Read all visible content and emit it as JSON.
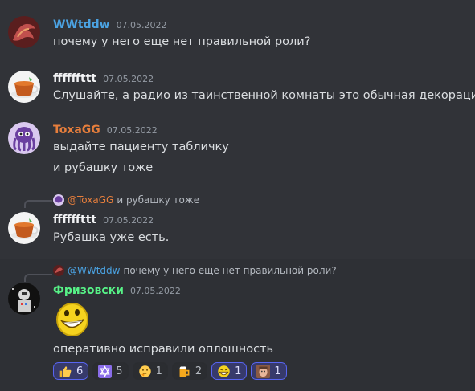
{
  "messages": [
    {
      "author": "WWtddw",
      "author_color": "#4ba3e3",
      "timestamp": "07.05.2022",
      "lines": [
        "почему у него еще нет правильной роли?"
      ]
    },
    {
      "author": "ffffffttt",
      "author_color": "#f2f3f5",
      "timestamp": "07.05.2022",
      "lines": [
        "Слушайте, а радио из таинственной комнаты это обычная декорация?"
      ]
    },
    {
      "author": "ToxaGG",
      "author_color": "#e67e3c",
      "timestamp": "07.05.2022",
      "lines": [
        "выдайте пациенту табличку",
        "и рубашку тоже"
      ]
    },
    {
      "author": "ffffffttt",
      "author_color": "#f2f3f5",
      "timestamp": "07.05.2022",
      "lines": [
        "Рубашка уже есть."
      ],
      "reply": {
        "mention": "@ToxaGG",
        "text": "и рубашку тоже",
        "mention_color": "#e67e3c"
      }
    },
    {
      "author": "Фризовски",
      "author_color": "#57f287",
      "timestamp": "07.05.2022",
      "lines": [
        "оперативно исправили оплошность"
      ],
      "reply": {
        "mention": "@WWtddw",
        "text": "почему у него еще нет правильной роли?",
        "mention_color": "#4ba3e3"
      }
    }
  ],
  "reactions": [
    {
      "icon": "thumbs-up-icon",
      "count": "6",
      "mine": true
    },
    {
      "icon": "star-of-david-icon",
      "count": "5",
      "mine": false
    },
    {
      "icon": "thinking-face-icon",
      "count": "1",
      "mine": false
    },
    {
      "icon": "beer-mug-icon",
      "count": "2",
      "mine": false
    },
    {
      "icon": "laughing-face-icon",
      "count": "1",
      "mine": true
    },
    {
      "icon": "custom-face-emoji-icon",
      "count": "1",
      "mine": true
    }
  ]
}
